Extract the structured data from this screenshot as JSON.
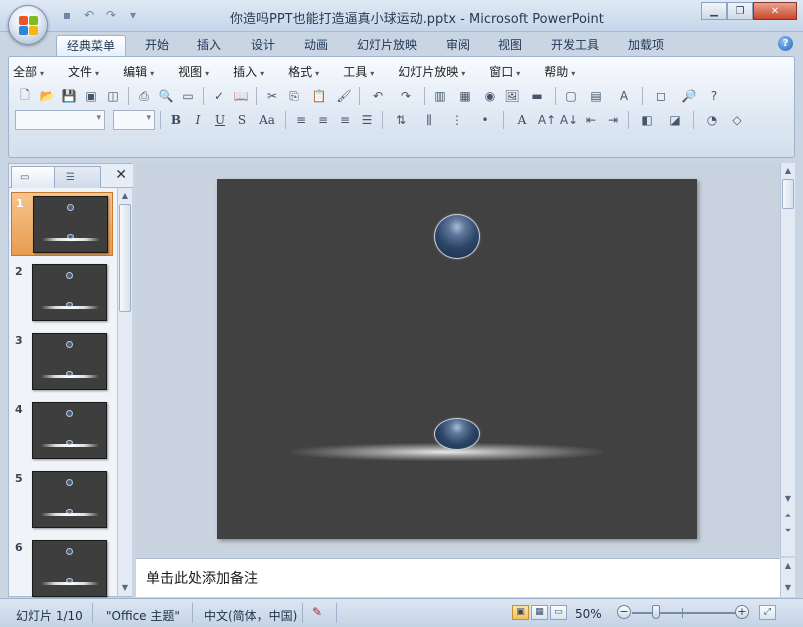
{
  "window": {
    "title": "你造吗PPT也能打造逼真小球运动.pptx - Microsoft PowerPoint"
  },
  "tabs": [
    {
      "label": "经典菜单",
      "active": true
    },
    {
      "label": "开始"
    },
    {
      "label": "插入"
    },
    {
      "label": "设计"
    },
    {
      "label": "动画"
    },
    {
      "label": "幻灯片放映"
    },
    {
      "label": "审阅"
    },
    {
      "label": "视图"
    },
    {
      "label": "开发工具"
    },
    {
      "label": "加载项"
    }
  ],
  "menu": [
    {
      "label": "全部"
    },
    {
      "label": "文件"
    },
    {
      "label": "编辑"
    },
    {
      "label": "视图"
    },
    {
      "label": "插入"
    },
    {
      "label": "格式"
    },
    {
      "label": "工具"
    },
    {
      "label": "幻灯片放映"
    },
    {
      "label": "窗口"
    },
    {
      "label": "帮助"
    }
  ],
  "format_buttons": {
    "bold": "B",
    "italic": "I",
    "underline": "U",
    "shadow": "S",
    "case": "Aa",
    "font_color": "A"
  },
  "thumbnails": [
    {
      "num": "1",
      "selected": true
    },
    {
      "num": "2"
    },
    {
      "num": "3"
    },
    {
      "num": "4"
    },
    {
      "num": "5"
    },
    {
      "num": "6"
    }
  ],
  "notes": {
    "placeholder": "单击此处添加备注"
  },
  "status": {
    "slide": "幻灯片 1/10",
    "theme": "\"Office 主题\"",
    "language": "中文(简体，中国)",
    "zoom": "50%",
    "zoom_level": 0.5
  },
  "colors": {
    "slide_bg": "#414141",
    "ball": "#2c4566",
    "accent_selected": "#e89c4f"
  }
}
